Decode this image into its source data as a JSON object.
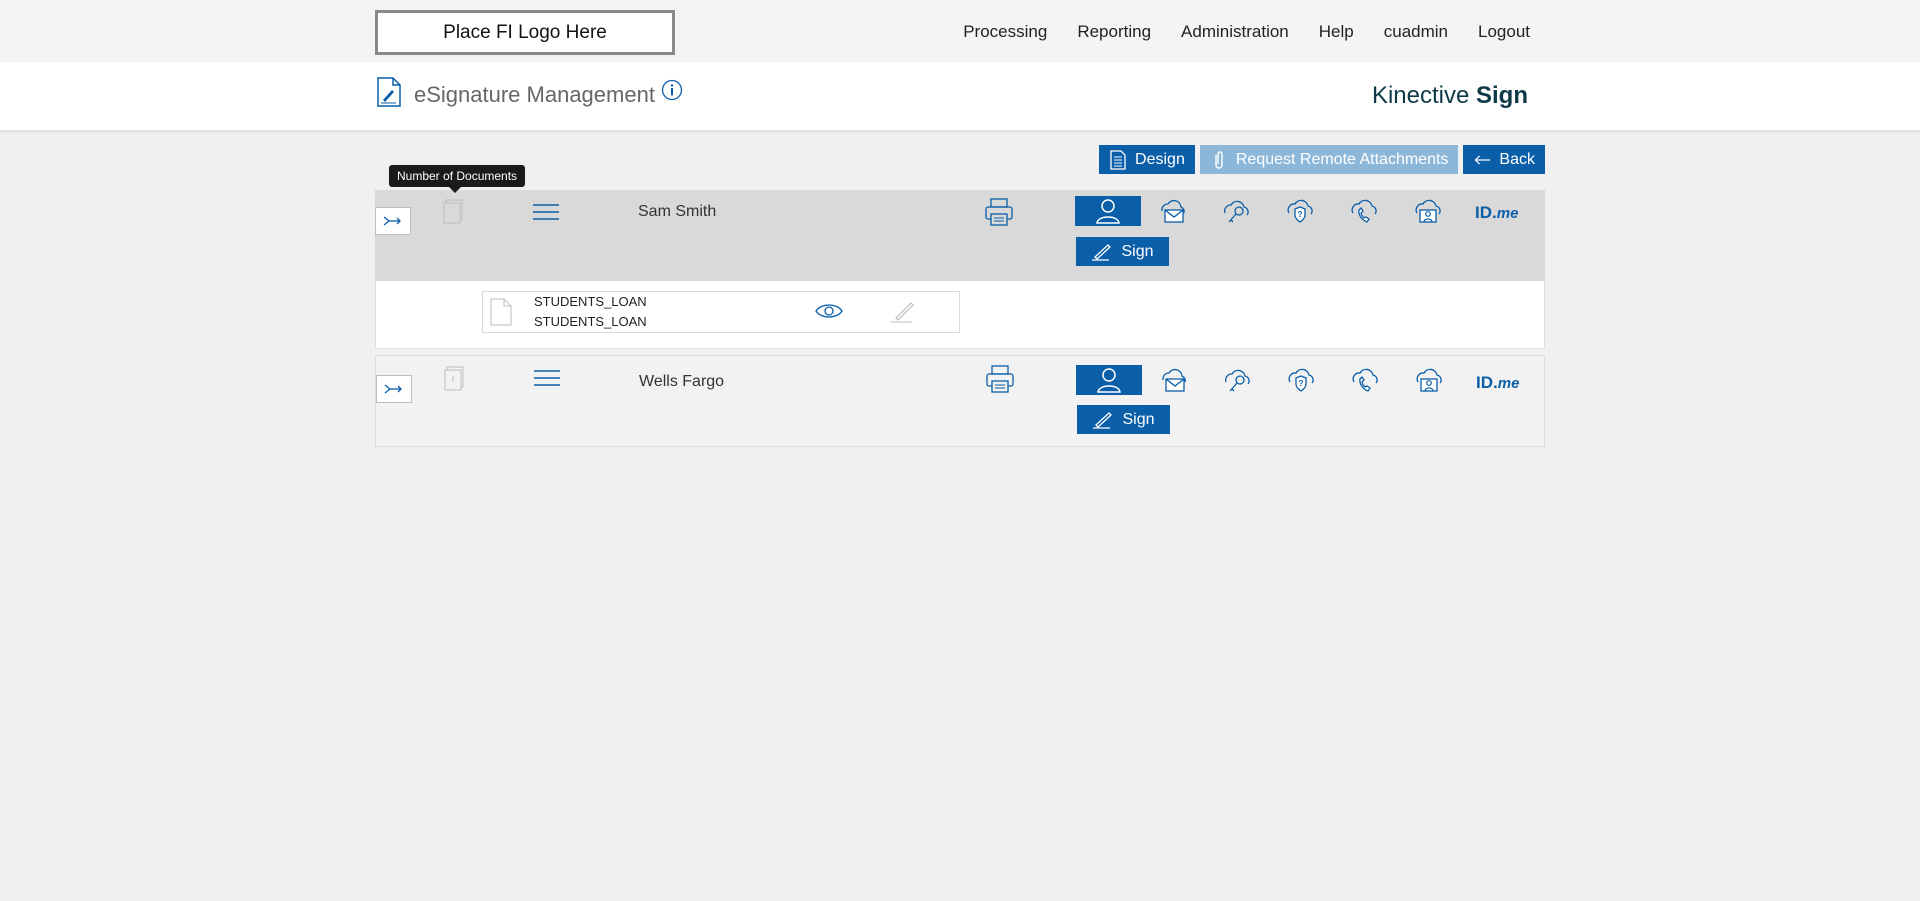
{
  "header": {
    "logo_placeholder": "Place FI Logo Here",
    "nav": [
      "Processing",
      "Reporting",
      "Administration",
      "Help",
      "cuadmin",
      "Logout"
    ]
  },
  "title": {
    "text": "eSignature Management",
    "brand_regular": "Kinective",
    "brand_bold": "Sign"
  },
  "actions": {
    "design_label": "Design",
    "remote_attachments_label": "Request Remote Attachments",
    "back_label": "Back"
  },
  "tooltip": "Number of Documents",
  "rows": [
    {
      "name": "Sam Smith",
      "sign_label": "Sign",
      "idme_id": "ID.",
      "idme_me": "me",
      "documents": [
        {
          "line1": "STUDENTS_LOAN",
          "line2": "STUDENTS_LOAN"
        }
      ]
    },
    {
      "name": "Wells Fargo",
      "sign_label": "Sign",
      "idme_id": "ID.",
      "idme_me": "me"
    }
  ],
  "colors": {
    "accent": "#0b5ea8",
    "accent_disabled": "#8db7d9",
    "row_selected": "#d9d9d9",
    "brand": "#0e3a48"
  },
  "icons": [
    "document-pen-icon",
    "info-icon",
    "design-list-icon",
    "paperclip-icon",
    "arrow-left-icon",
    "expand-arrow-icon",
    "document-count-icon",
    "menu-icon",
    "printer-icon",
    "person-icon",
    "cloud-mail-icon",
    "cloud-key-icon",
    "cloud-question-icon",
    "cloud-phone-icon",
    "cloud-id-icon",
    "idme-logo",
    "pen-icon",
    "page-icon",
    "eye-icon"
  ]
}
